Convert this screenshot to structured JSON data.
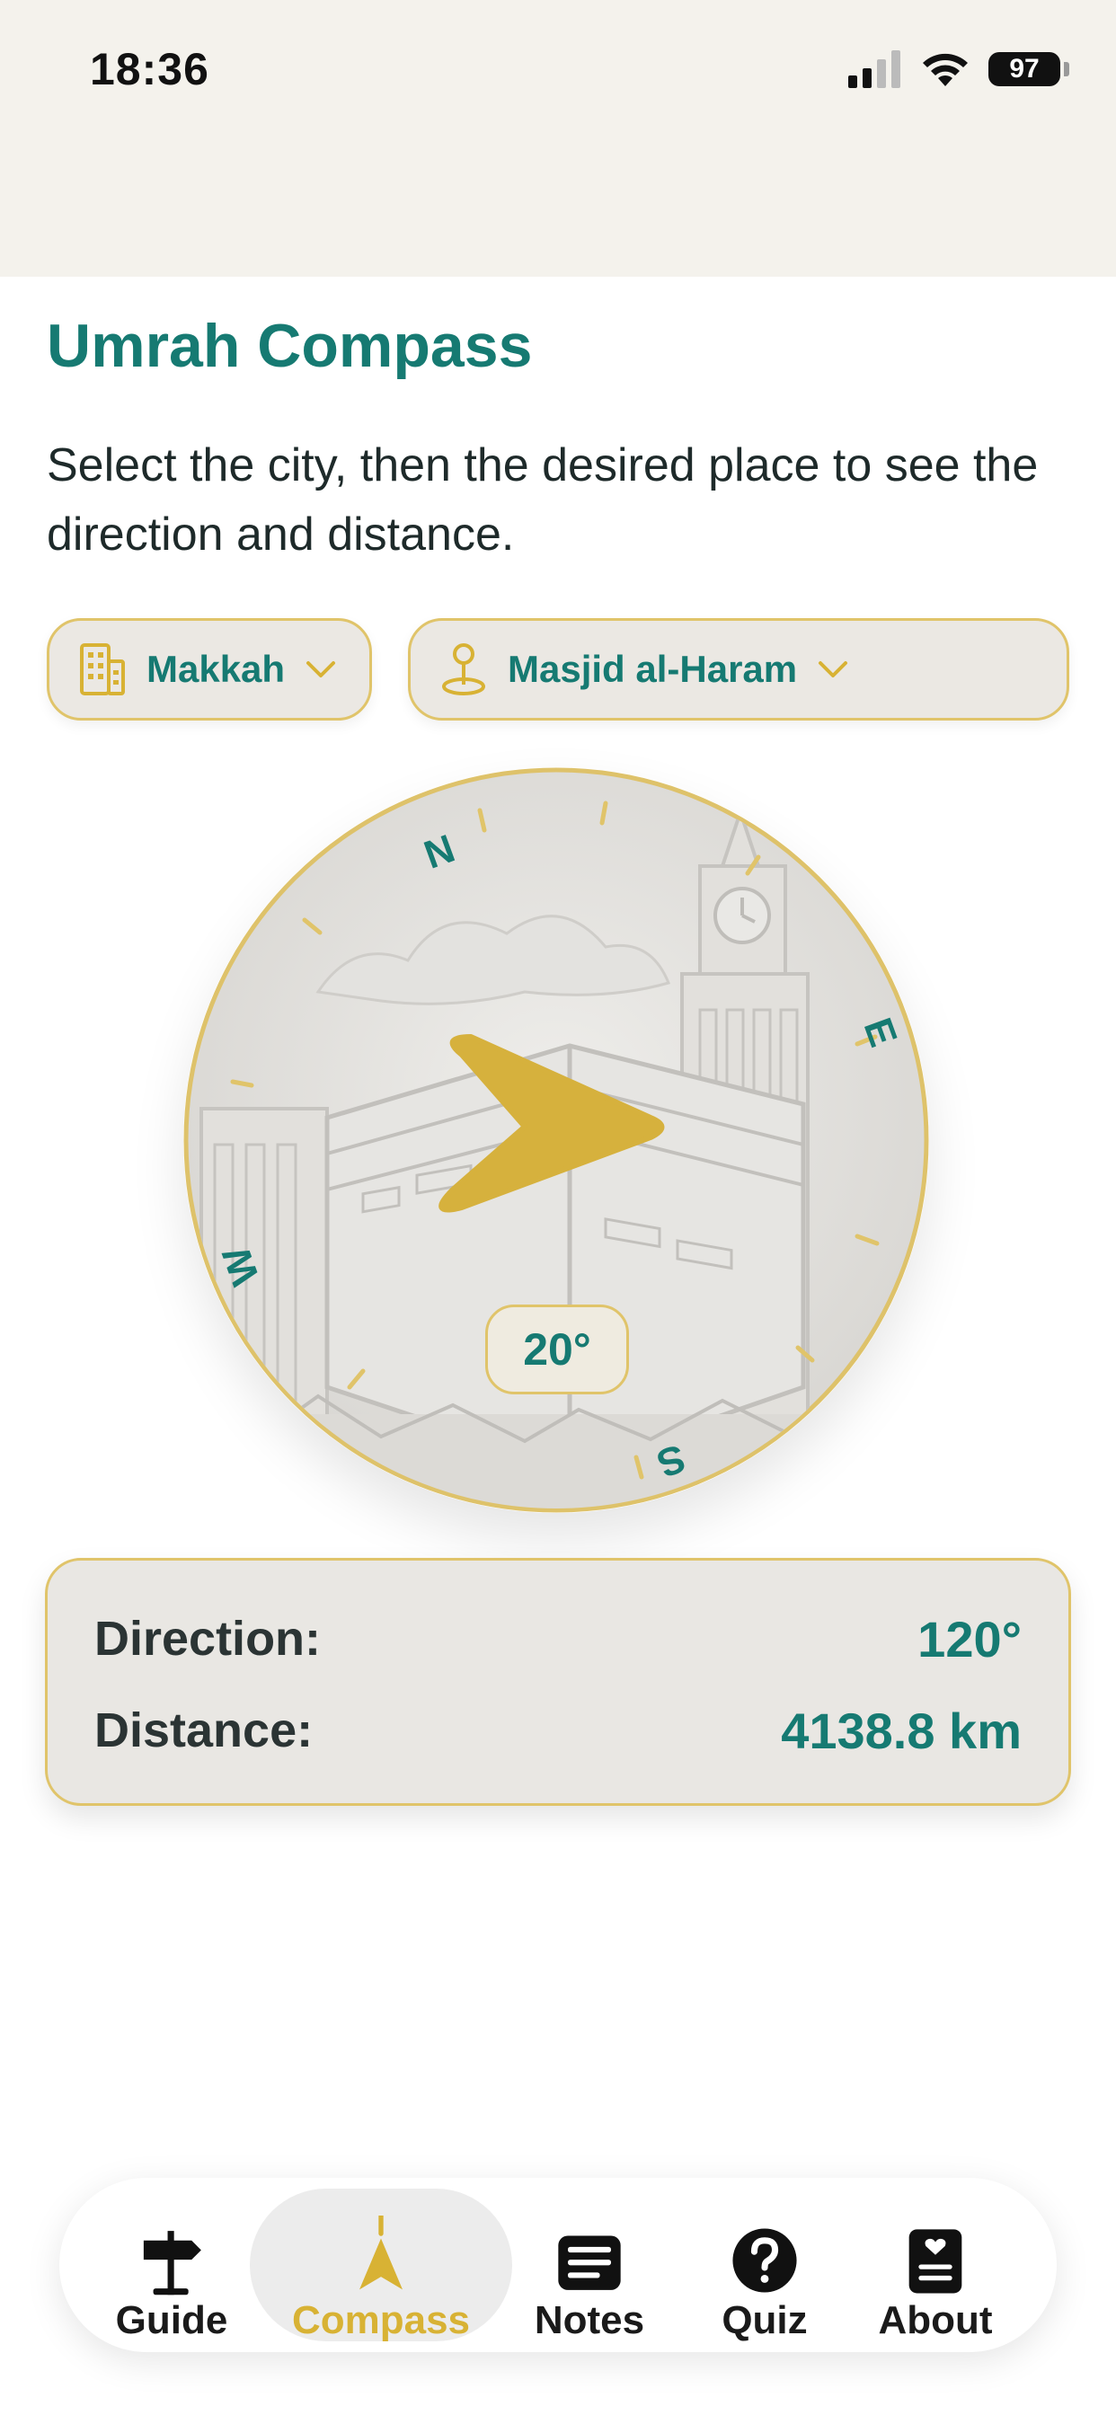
{
  "status": {
    "time": "18:36",
    "battery": "97"
  },
  "header": {
    "title": "Umrah Compass",
    "subtitle": "Select the city, then the desired place to see the direction and distance."
  },
  "selectors": {
    "city": "Makkah",
    "place": "Masjid al-Haram"
  },
  "compass": {
    "letters": {
      "n": "N",
      "e": "E",
      "s": "S",
      "w": "W"
    },
    "heading": "20°"
  },
  "info": {
    "direction_label": "Direction:",
    "direction_value": "120°",
    "distance_label": "Distance:",
    "distance_value": "4138.8 km"
  },
  "tabs": [
    {
      "label": "Guide"
    },
    {
      "label": "Compass"
    },
    {
      "label": "Notes"
    },
    {
      "label": "Quiz"
    },
    {
      "label": "About"
    }
  ],
  "colors": {
    "accent": "#167a72",
    "gold": "#d8b234"
  }
}
